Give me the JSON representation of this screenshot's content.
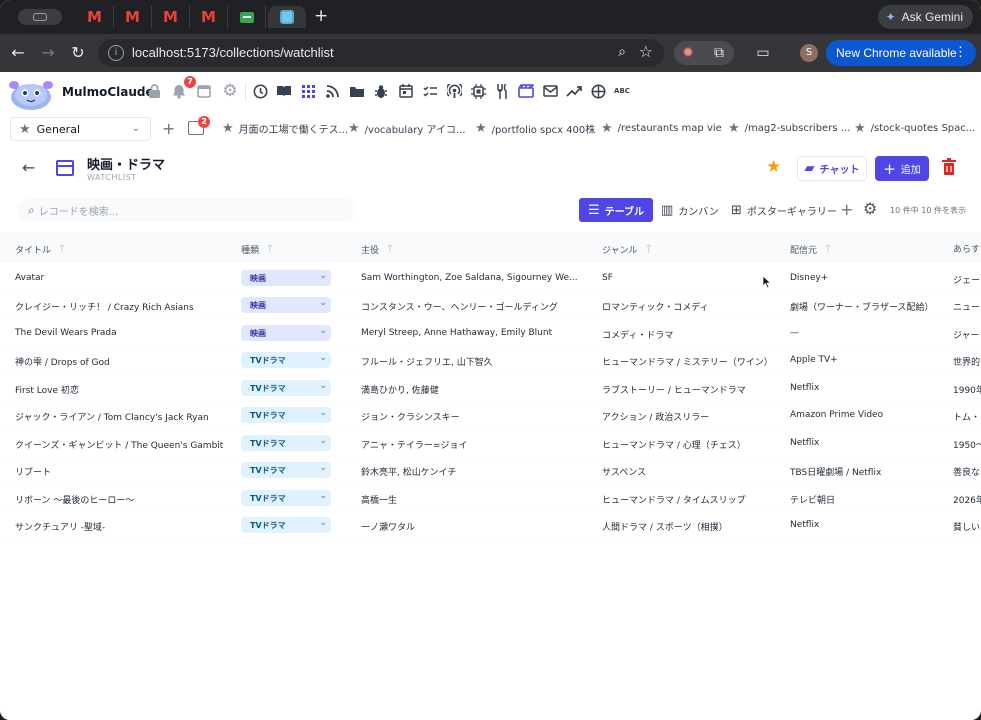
{
  "browser": {
    "ask_gemini": "Ask Gemini",
    "url": "localhost:5173/collections/watchlist",
    "new_chrome": "New Chrome available",
    "profile_initial": "S",
    "tabs": [
      "gmail",
      "gmail",
      "gmail",
      "gmail",
      "sheets",
      "mulmo"
    ]
  },
  "app": {
    "brand": "MulmoClaude",
    "notifications_badge": "7",
    "session_badge": "2",
    "session_select": "General",
    "toolbar_icons": [
      "lock-icon",
      "bell-icon",
      "calendar-icon",
      "gear-icon",
      "clock-icon",
      "book-icon",
      "grid-icon",
      "rss-icon",
      "folder-icon",
      "bug-icon",
      "calendar-check-icon",
      "checklist-icon",
      "podcast-icon",
      "chip-icon",
      "fork-knife-icon",
      "clapperboard-icon",
      "mail-icon",
      "trend-icon",
      "circle-half-icon",
      "abc-icon"
    ],
    "abc_label": "ABC",
    "bookmarks": [
      "月面の工場で働くテス...",
      "/vocabulary アイコ...",
      "/portfolio spcx 400株",
      "/restaurants map vie",
      "/mag2-subscribers ...",
      "/stock-quotes Spac..."
    ]
  },
  "page": {
    "title": "映画・ドラマ",
    "subtitle": "WATCHLIST",
    "chat_label": "チャット",
    "add_label": "追加",
    "search_placeholder": "レコードを検索...",
    "views": {
      "table": "テーブル",
      "kanban": "カンバン",
      "poster": "ポスターギャラリー"
    },
    "count_text": "10 件中 10 件を表示"
  },
  "table": {
    "headers": [
      "タイトル",
      "種類",
      "主役",
      "ジャンル",
      "配信元",
      "あらすじ"
    ],
    "rows": [
      {
        "title": "Avatar",
        "type": "映画",
        "cast": "Sam Worthington, Zoe Saldana, Sigourney We...",
        "genre": "SF",
        "source": "Disney+",
        "synopsis": "ジェー"
      },
      {
        "title": "クレイジー・リッチ！ / Crazy Rich Asians",
        "type": "映画",
        "cast": "コンスタンス・ウー、ヘンリー・ゴールディング",
        "genre": "ロマンティック・コメディ",
        "source": "劇場（ワーナー・ブラザース配給）",
        "synopsis": "ニュー"
      },
      {
        "title": "The Devil Wears Prada",
        "type": "映画",
        "cast": "Meryl Streep, Anne Hathaway, Emily Blunt",
        "genre": "コメディ・ドラマ",
        "source": "—",
        "synopsis": "ジャー"
      },
      {
        "title": "神の雫 / Drops of God",
        "type": "TVドラマ",
        "cast": "フルール・ジェフリエ, 山下智久",
        "genre": "ヒューマンドラマ / ミステリー（ワイン）",
        "source": "Apple TV+",
        "synopsis": "世界的"
      },
      {
        "title": "First Love 初恋",
        "type": "TVドラマ",
        "cast": "満島ひかり, 佐藤健",
        "genre": "ラブストーリー / ヒューマンドラマ",
        "source": "Netflix",
        "synopsis": "1990年"
      },
      {
        "title": "ジャック・ライアン / Tom Clancy's Jack Ryan",
        "type": "TVドラマ",
        "cast": "ジョン・クラシンスキー",
        "genre": "アクション / 政治スリラー",
        "source": "Amazon Prime Video",
        "synopsis": "トム・"
      },
      {
        "title": "クイーンズ・ギャンビット / The Queen's Gambit",
        "type": "TVドラマ",
        "cast": "アニャ・テイラー=ジョイ",
        "genre": "ヒューマンドラマ / 心理（チェス）",
        "source": "Netflix",
        "synopsis": "1950～"
      },
      {
        "title": "リブート",
        "type": "TVドラマ",
        "cast": "鈴木亮平, 松山ケンイチ",
        "genre": "サスペンス",
        "source": "TBS日曜劇場 / Netflix",
        "synopsis": "善良な"
      },
      {
        "title": "リボーン 〜最後のヒーロー〜",
        "type": "TVドラマ",
        "cast": "高橋一生",
        "genre": "ヒューマンドラマ / タイムスリップ",
        "source": "テレビ朝日",
        "synopsis": "2026年"
      },
      {
        "title": "サンクチュアリ -聖域-",
        "type": "TVドラマ",
        "cast": "一ノ瀬ワタル",
        "genre": "人間ドラマ / スポーツ（相撲）",
        "source": "Netflix",
        "synopsis": "貧しい"
      }
    ]
  },
  "colors": {
    "accent": "#4f46e5",
    "movie_chip": "#e0e7ff",
    "tv_chip": "#e0f2fe",
    "delete": "#dc2626",
    "star": "#f59e0b"
  }
}
